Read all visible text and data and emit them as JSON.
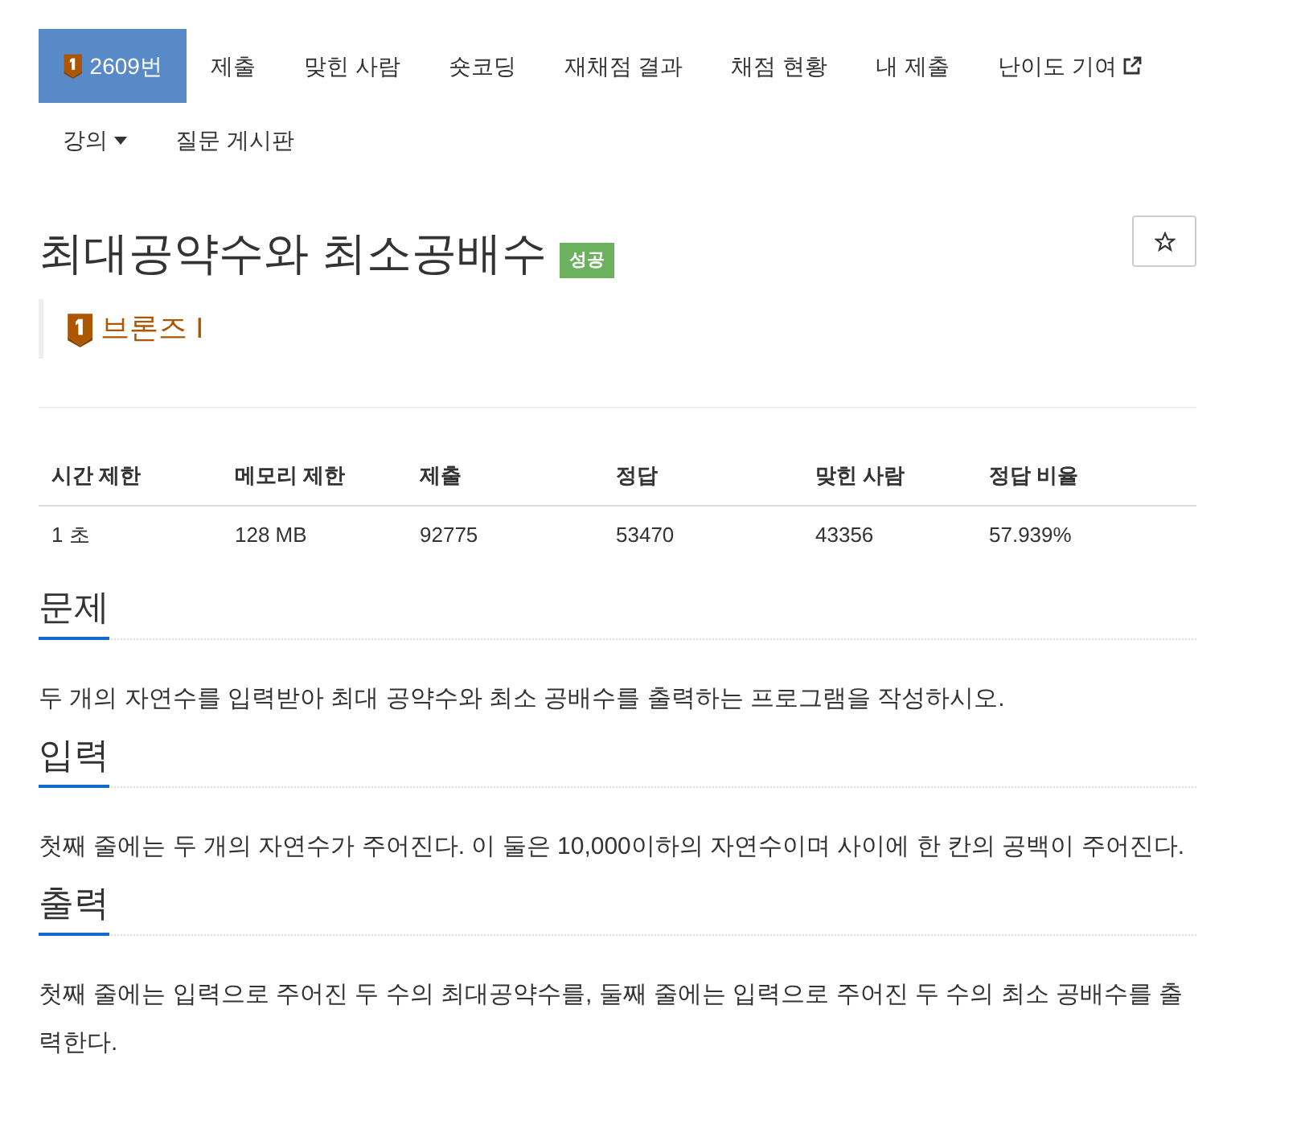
{
  "nav": {
    "rows": [
      {
        "items": [
          {
            "label": "2609번",
            "kind": "problem",
            "selected": true
          },
          {
            "label": "제출",
            "kind": "link",
            "selected": false
          },
          {
            "label": "맞힌 사람",
            "kind": "link",
            "selected": false
          },
          {
            "label": "숏코딩",
            "kind": "link",
            "selected": false
          },
          {
            "label": "재채점 결과",
            "kind": "link",
            "selected": false
          },
          {
            "label": "채점 현황",
            "kind": "link",
            "selected": false
          },
          {
            "label": "내 제출",
            "kind": "link",
            "selected": false
          },
          {
            "label": "난이도 기여",
            "kind": "external",
            "selected": false
          }
        ]
      },
      {
        "items": [
          {
            "label": "강의",
            "kind": "dropdown",
            "selected": false
          },
          {
            "label": "질문 게시판",
            "kind": "link",
            "selected": false
          }
        ]
      }
    ]
  },
  "problem": {
    "title": "최대공약수와 최소공배수",
    "result_label": "성공",
    "starred": false,
    "tier": "브론즈 I"
  },
  "table": {
    "columns": [
      "시간 제한",
      "메모리 제한",
      "제출",
      "정답",
      "맞힌 사람",
      "정답 비율"
    ],
    "rows": [
      [
        "1 초",
        "128 MB",
        "92775",
        "53470",
        "43356",
        "57.939%"
      ]
    ]
  },
  "sections": [
    {
      "heading": "문제",
      "text": "두 개의 자연수를 입력받아 최대 공약수와 최소 공배수를 출력하는 프로그램을 작성하시오."
    },
    {
      "heading": "입력",
      "text": "첫째 줄에는 두 개의 자연수가 주어진다. 이 둘은 10,000이하의 자연수이며 사이에 한 칸의 공백이 주어진다."
    },
    {
      "heading": "출력",
      "text": "첫째 줄에는 입력으로 주어진 두 수의 최대공약수를, 둘째 줄에는 입력으로 주어진 두 수의 최소 공배수를 출력한다."
    }
  ]
}
